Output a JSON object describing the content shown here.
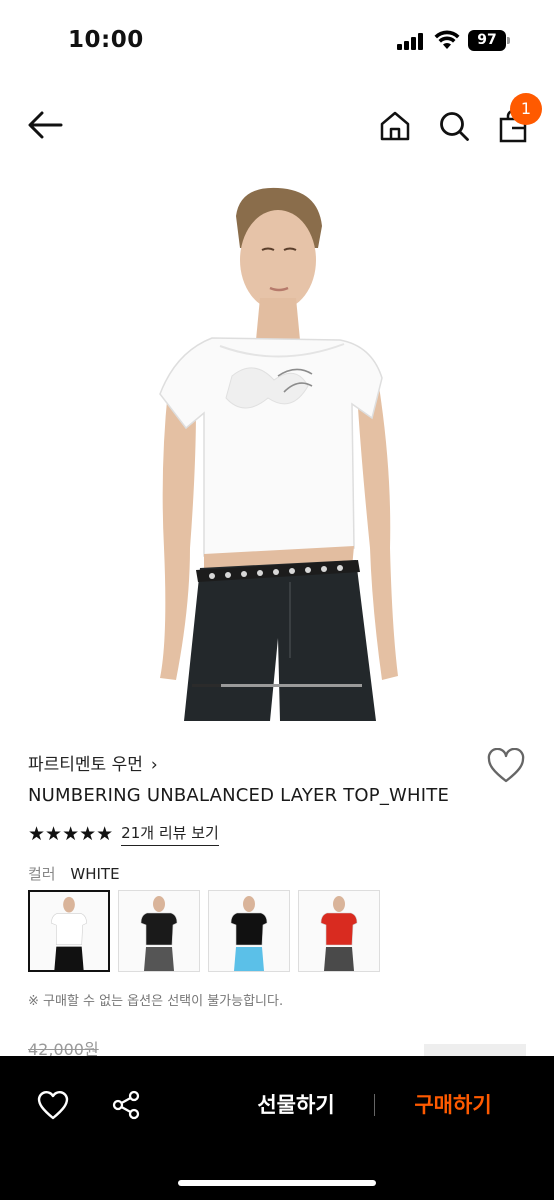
{
  "status_bar": {
    "time": "10:00",
    "battery": "97"
  },
  "header": {
    "back_icon": "arrow-left-icon",
    "home_icon": "home-icon",
    "search_icon": "search-icon",
    "cart_icon": "shopping-bag-icon",
    "cart_badge": "1",
    "badge_color": "#ff5a00"
  },
  "gallery": {
    "progress": 0.17
  },
  "product": {
    "brand": "파르티멘토 우먼",
    "brand_chevron": "›",
    "name": "NUMBERING UNBALANCED LAYER TOP_WHITE",
    "stars": "★★★★★",
    "review_link": "21개 리뷰 보기",
    "color_label": "컬러",
    "color_value": "WHITE",
    "swatches": [
      {
        "name": "white",
        "top_color": "#ffffff",
        "bottom_color": "#111111"
      },
      {
        "name": "black-gray",
        "top_color": "#1a1a1a",
        "bottom_color": "#555555"
      },
      {
        "name": "black-blue",
        "top_color": "#111111",
        "bottom_color": "#5bc0e8"
      },
      {
        "name": "red-gray",
        "top_color": "#d92b20",
        "bottom_color": "#4a4a4a"
      }
    ],
    "notice": "※ 구매할 수 없는 옵션은 선택이 불가능합니다.",
    "original_price": "42,000원"
  },
  "bottom_bar": {
    "like_icon": "heart-outline-icon",
    "share_icon": "share-icon",
    "gift_label": "선물하기",
    "buy_label": "구매하기",
    "accent": "#ff5a00"
  }
}
